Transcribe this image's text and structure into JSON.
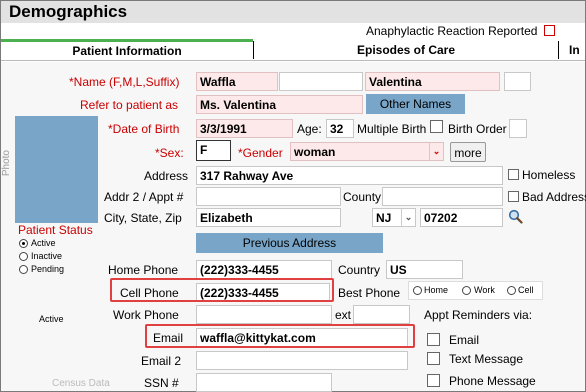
{
  "header": {
    "title": "Demographics",
    "anaphylactic_label": "Anaphylactic Reaction Reported"
  },
  "tabs": [
    {
      "label": "Patient Information"
    },
    {
      "label": "Episodes of Care"
    },
    {
      "label": "In"
    }
  ],
  "photo_label": "Photo",
  "name": {
    "label": "*Name (F,M,L,Suffix)",
    "first": "Waffla",
    "middle": "",
    "last": "Valentina",
    "suffix": ""
  },
  "refer": {
    "label": "Refer to patient as",
    "value": "Ms. Valentina",
    "other_names_button": "Other Names"
  },
  "dob": {
    "label": "*Date of Birth",
    "value": "3/3/1991",
    "age_label": "Age:",
    "age": "32",
    "multiple_birth_label": "Multiple Birth",
    "birth_order_label": "Birth Order",
    "birth_order": ""
  },
  "sex": {
    "label": "*Sex:",
    "value": "F",
    "gender_label": "*Gender",
    "gender_value": "woman",
    "more_button": "more"
  },
  "address": {
    "label": "Address",
    "value": "317 Rahway Ave",
    "homeless_label": "Homeless"
  },
  "addr2": {
    "label": "Addr 2 / Appt #",
    "value": "",
    "county_label": "County",
    "county_value": "",
    "bad_address_label": "Bad Address"
  },
  "city": {
    "label": "City, State, Zip",
    "city": "Elizabeth",
    "state": "NJ",
    "zip": "07202"
  },
  "previous_address_button": "Previous Address",
  "patient_status": {
    "title": "Patient Status",
    "options": [
      "Active",
      "Inactive",
      "Pending"
    ],
    "selected": "Active",
    "current": "Active"
  },
  "home_phone": {
    "label": "Home Phone",
    "value": "(222)333-4455",
    "country_label": "Country",
    "country_value": "US"
  },
  "cell_phone": {
    "label": "Cell Phone",
    "value": "(222)333-4455",
    "best_phone_label": "Best Phone",
    "options": [
      "Home",
      "Work",
      "Cell"
    ]
  },
  "work_phone": {
    "label": "Work Phone",
    "value": "",
    "ext_label": "ext",
    "ext_value": "",
    "reminders_label": "Appt Reminders via:"
  },
  "email": {
    "label": "Email",
    "value": "waffla@kittykat.com",
    "reminder_email": "Email"
  },
  "email2": {
    "label": "Email 2",
    "value": "",
    "reminder_text": "Text Message"
  },
  "ssn": {
    "label": "SSN #",
    "value": "",
    "reminder_phone": "Phone Message"
  },
  "census_label": "Census Data",
  "colors": {
    "accent_blue": "#78a5c8",
    "required_red": "#cc0000",
    "highlight_red": "#e04040",
    "tab_green": "#4caf50"
  }
}
